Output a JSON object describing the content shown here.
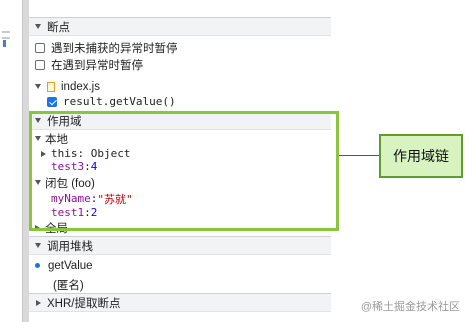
{
  "breakpoints": {
    "header": "断点",
    "pause_uncaught": "遇到未捕获的异常时暂停",
    "pause_caught": "在遇到异常时暂停",
    "file_name": "index.js",
    "breakpoint_line": "result.getValue()"
  },
  "scope": {
    "header": "作用域",
    "local_label": "本地",
    "this_label": "this: Object",
    "test3_name": "test3",
    "test3_value": "4",
    "closure_label": "闭包 (foo)",
    "myName_name": "myName",
    "myName_value": "\"苏就\"",
    "test1_name": "test1",
    "test1_value": "2",
    "global_label": "全局"
  },
  "call_stack": {
    "header": "调用堆栈",
    "frame1": "getValue",
    "frame2": "(匿名)"
  },
  "xhr": {
    "header": "XHR/提取断点"
  },
  "callout": {
    "label": "作用域链"
  },
  "watermark": "@稀土掘金技术社区",
  "colors": {
    "highlight_border": "#8bc53f",
    "callout_fill": "#d8f3bf",
    "callout_border": "#5f9b2e",
    "property_name": "#881391",
    "number_value": "#1c00cf",
    "string_value": "#c80000",
    "checkbox_blue": "#1a73e8"
  }
}
